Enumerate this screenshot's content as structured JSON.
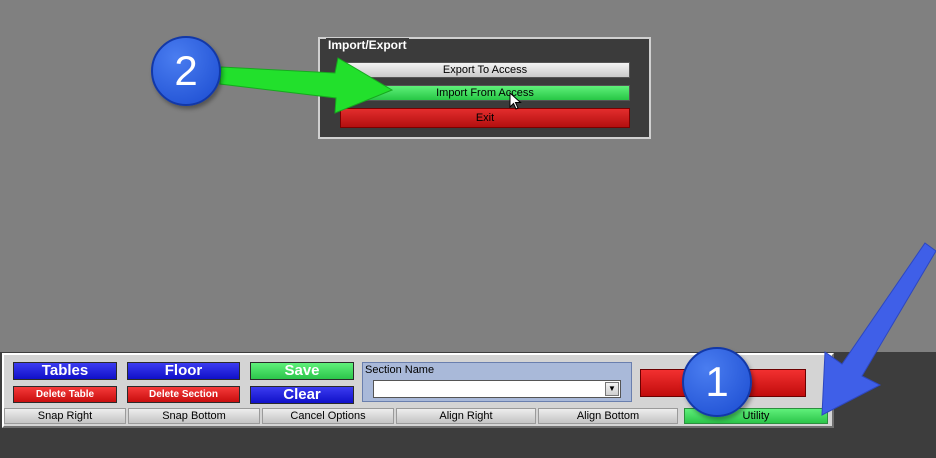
{
  "dialog": {
    "title": "Import/Export",
    "buttons": {
      "export": "Export To Access",
      "import": "Import From Access",
      "exit": "Exit"
    }
  },
  "annotations": {
    "step1": "1",
    "step2": "2",
    "badge_color": "#1a4bd0",
    "arrow1_color": "#3f5fe8",
    "arrow2_color": "#22e02c"
  },
  "toolbar": {
    "tables": "Tables",
    "floor": "Floor",
    "save": "Save",
    "delete_table": "Delete Table",
    "delete_section": "Delete Section",
    "clear": "Clear",
    "section_name_label": "Section Name",
    "section_name_value": "",
    "snap_right": "Snap Right",
    "snap_bottom": "Snap Bottom",
    "cancel_options": "Cancel Options",
    "align_right": "Align Right",
    "align_bottom": "Align Bottom",
    "utility": "Utility"
  },
  "colors": {
    "canvas": "#808080",
    "blue_button": "#1a1ad8",
    "red_button": "#d81a1a",
    "green_button": "#3ad95a"
  }
}
